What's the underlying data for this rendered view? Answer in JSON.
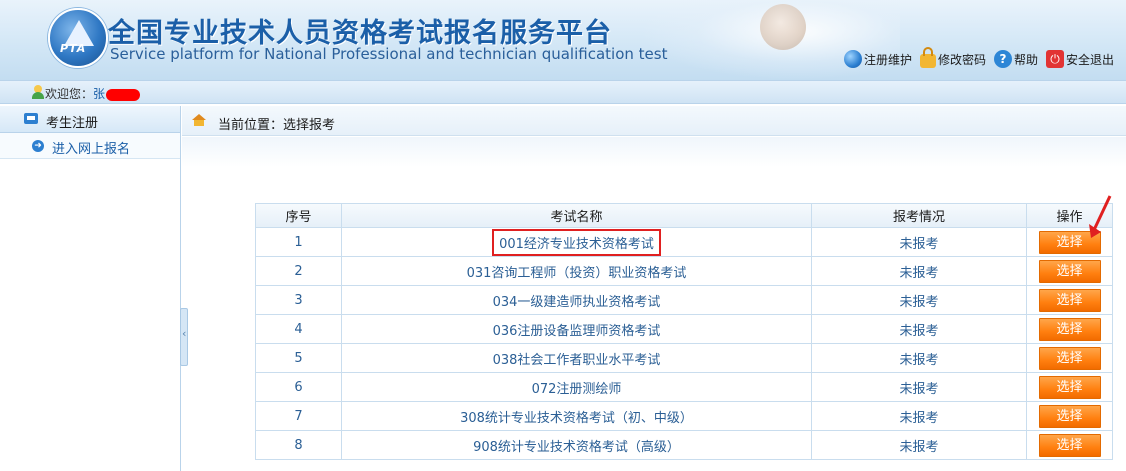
{
  "header": {
    "title_cn": "全国专业技术人员资格考试报名服务平台",
    "title_en": "Service platform for National Professional and technician qualification test",
    "logo_text": "PTA",
    "links": [
      {
        "label": "注册维护",
        "icon": "globe-icon"
      },
      {
        "label": "修改密码",
        "icon": "lock-icon"
      },
      {
        "label": "帮助",
        "icon": "help-icon"
      },
      {
        "label": "安全退出",
        "icon": "power-icon"
      }
    ]
  },
  "welcome": {
    "prefix": "欢迎您：",
    "name": "张"
  },
  "sidebar": {
    "section": "考生注册",
    "items": [
      {
        "label": "进入网上报名"
      }
    ]
  },
  "breadcrumb": {
    "text": "当前位置：选择报考"
  },
  "table": {
    "headers": [
      "序号",
      "考试名称",
      "报考情况",
      "操作"
    ],
    "rows": [
      {
        "idx": "1",
        "name": "001经济专业技术资格考试",
        "status": "未报考",
        "action": "选择"
      },
      {
        "idx": "2",
        "name": "031咨询工程师（投资）职业资格考试",
        "status": "未报考",
        "action": "选择"
      },
      {
        "idx": "3",
        "name": "034一级建造师执业资格考试",
        "status": "未报考",
        "action": "选择"
      },
      {
        "idx": "4",
        "name": "036注册设备监理师资格考试",
        "status": "未报考",
        "action": "选择"
      },
      {
        "idx": "5",
        "name": "038社会工作者职业水平考试",
        "status": "未报考",
        "action": "选择"
      },
      {
        "idx": "6",
        "name": "072注册测绘师",
        "status": "未报考",
        "action": "选择"
      },
      {
        "idx": "7",
        "name": "308统计专业技术资格考试（初、中级）",
        "status": "未报考",
        "action": "选择"
      },
      {
        "idx": "8",
        "name": "908统计专业技术资格考试（高级）",
        "status": "未报考",
        "action": "选择"
      }
    ]
  },
  "colors": {
    "brand_blue": "#1b5fa8",
    "button_orange": "#ff7f0f",
    "highlight_red": "#e02020"
  }
}
